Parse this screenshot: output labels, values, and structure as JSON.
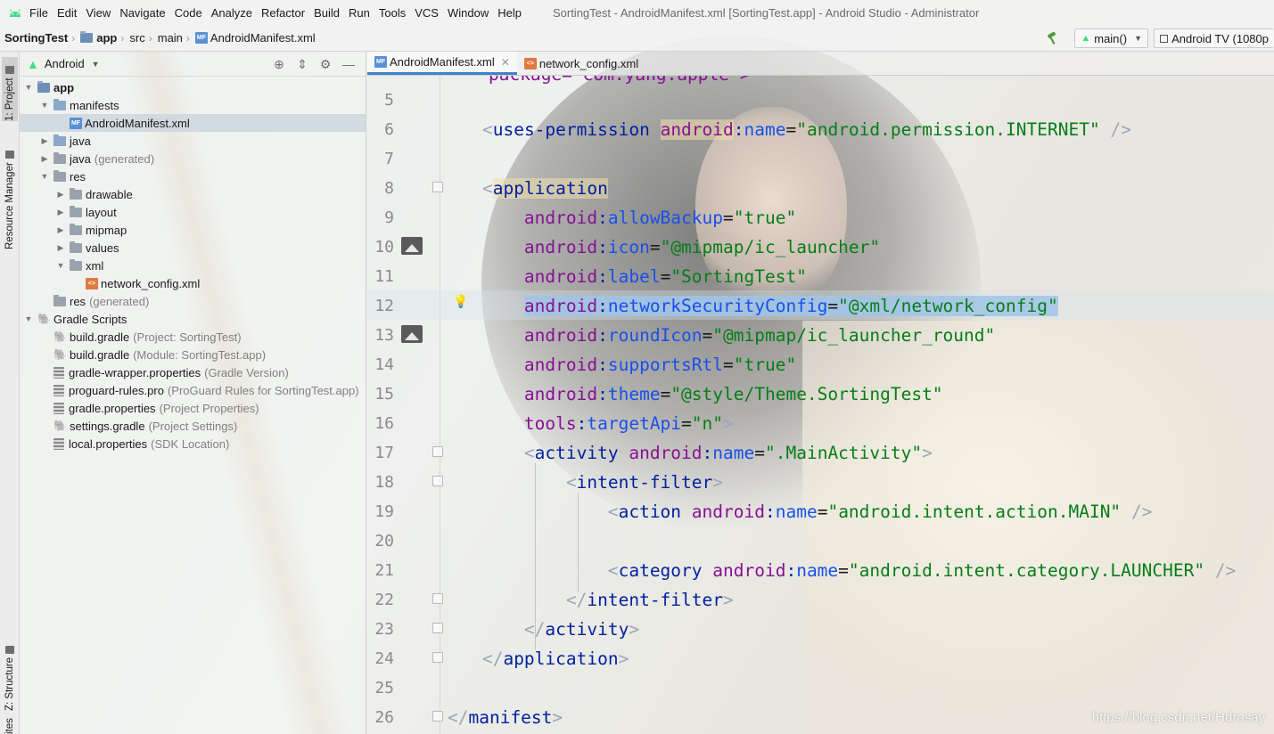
{
  "menubar": {
    "items": [
      "File",
      "Edit",
      "View",
      "Navigate",
      "Code",
      "Analyze",
      "Refactor",
      "Build",
      "Run",
      "Tools",
      "VCS",
      "Window",
      "Help"
    ],
    "window_title": "SortingTest - AndroidManifest.xml [SortingTest.app] - Android Studio - Administrator"
  },
  "navbar": {
    "crumbs": [
      "SortingTest",
      "app",
      "src",
      "main",
      "AndroidManifest.xml"
    ],
    "branch": "main()",
    "device": "Android TV (1080p"
  },
  "toolstrip": {
    "project": "1: Project",
    "resource": "Resource Manager",
    "structure": "Z: Structure",
    "favorites": "ites"
  },
  "project_panel": {
    "view_mode": "Android",
    "tree": [
      {
        "label": "app",
        "sub": ""
      },
      {
        "label": "manifests",
        "sub": ""
      },
      {
        "label": "AndroidManifest.xml",
        "sub": ""
      },
      {
        "label": "java",
        "sub": ""
      },
      {
        "label": "java",
        "sub": "(generated)"
      },
      {
        "label": "res",
        "sub": ""
      },
      {
        "label": "drawable",
        "sub": ""
      },
      {
        "label": "layout",
        "sub": ""
      },
      {
        "label": "mipmap",
        "sub": ""
      },
      {
        "label": "values",
        "sub": ""
      },
      {
        "label": "xml",
        "sub": ""
      },
      {
        "label": "network_config.xml",
        "sub": ""
      },
      {
        "label": "res",
        "sub": "(generated)"
      },
      {
        "label": "Gradle Scripts",
        "sub": ""
      },
      {
        "label": "build.gradle",
        "sub": "(Project: SortingTest)"
      },
      {
        "label": "build.gradle",
        "sub": "(Module: SortingTest.app)"
      },
      {
        "label": "gradle-wrapper.properties",
        "sub": "(Gradle Version)"
      },
      {
        "label": "proguard-rules.pro",
        "sub": "(ProGuard Rules for SortingTest.app)"
      },
      {
        "label": "gradle.properties",
        "sub": "(Project Properties)"
      },
      {
        "label": "settings.gradle",
        "sub": "(Project Settings)"
      },
      {
        "label": "local.properties",
        "sub": "(SDK Location)"
      }
    ]
  },
  "editor": {
    "tabs": [
      "AndroidManifest.xml",
      "network_config.xml"
    ],
    "line_numbers": [
      "5",
      "6",
      "7",
      "8",
      "9",
      "10",
      "11",
      "12",
      "13",
      "14",
      "15",
      "16",
      "17",
      "18",
      "19",
      "20",
      "21",
      "22",
      "23",
      "24",
      "25",
      "26"
    ],
    "partial_top_line": "package=\"com.yang.apple\">",
    "lines": {
      "l6_tag": "uses-permission",
      "l6_ns": "android",
      "l6_attr": "name",
      "l6_val": "\"android.permission.INTERNET\"",
      "l8_tag": "application",
      "l9_attr": "allowBackup",
      "l9_val": "\"true\"",
      "l10_attr": "icon",
      "l10_val": "\"@mipmap/ic_launcher\"",
      "l11_attr": "label",
      "l11_val": "\"SortingTest\"",
      "l12_attr": "networkSecurityConfig",
      "l12_val": "\"@xml/network_config\"",
      "l13_attr": "roundIcon",
      "l13_val": "\"@mipmap/ic_launcher_round\"",
      "l14_attr": "supportsRtl",
      "l14_val": "\"true\"",
      "l15_attr": "theme",
      "l15_val": "\"@style/Theme.SortingTest\"",
      "l16_ns": "tools",
      "l16_attr": "targetApi",
      "l16_val": "\"n\"",
      "l17_tag": "activity",
      "l17_val": "\".MainActivity\"",
      "l18_tag": "intent-filter",
      "l19_tag": "action",
      "l19_val": "\"android.intent.action.MAIN\"",
      "l21_tag": "category",
      "l21_val": "\"android.intent.category.LAUNCHER\"",
      "l22_tag": "intent-filter",
      "l23_tag": "activity",
      "l24_tag": "application",
      "l26_tag": "manifest"
    }
  },
  "watermark": "https://blog.csdn.net/Hdrosay",
  "colors": {
    "xml_tag": "#001f9e",
    "attr": "#1750eb",
    "namespace": "#871094",
    "value": "#067d17",
    "selection": "#a0c4e8"
  }
}
